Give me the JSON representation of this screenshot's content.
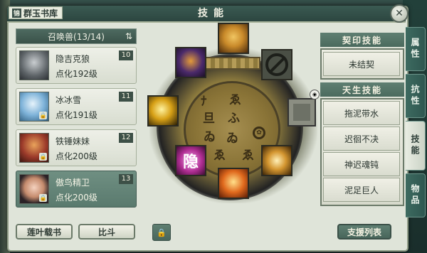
{
  "header": {
    "library_logo": "锦",
    "library_name": "群玉书库",
    "title": "技能",
    "close_glyph": "✕"
  },
  "pet_list": {
    "title": "召唤兽(13/14)",
    "sort_glyph": "⇅",
    "items": [
      {
        "name": "隐吉克狼",
        "level": "点化192级",
        "rank": "10",
        "locked": false,
        "selected": false,
        "avatar_color": "#7b7f82"
      },
      {
        "name": "冰冰雪",
        "level": "点化191级",
        "rank": "11",
        "locked": true,
        "selected": false,
        "avatar_color": "#6fa3c9"
      },
      {
        "name": "铁锤妹妹",
        "level": "点化200级",
        "rank": "12",
        "locked": true,
        "selected": false,
        "avatar_color": "#9b3a2a"
      },
      {
        "name": "傲鸟精卫",
        "level": "点化200级",
        "rank": "13",
        "locked": true,
        "selected": true,
        "avatar_color": "#c58b6d"
      }
    ]
  },
  "buttons": {
    "lotus": "莲叶载书",
    "compare": "比斗",
    "lock_glyph": "🔒",
    "assist_list": "支援列表"
  },
  "center": {
    "glyphs": [
      "ﾅ",
      "ゑ",
      "旦",
      "ふ",
      "ゐ",
      "ゐ",
      "ゑ",
      "ゑ"
    ],
    "seal_glyph": "隐",
    "wheel_glyph": "✿",
    "eye_glyph": "◉",
    "skill_colors": {
      "lion": "#c98a2a",
      "purple": "#4b2a6b",
      "lightning": "#d7a016",
      "seal": "#b02e93",
      "fire": "#e0691d",
      "swirl": "#d49630"
    }
  },
  "right_panel": {
    "contract_title": "契印技能",
    "contract_value": "未结契",
    "innate_title": "天生技能",
    "innate_skills": [
      "拖泥带水",
      "迟徊不决",
      "神迟魂钝",
      "泥足巨人"
    ]
  },
  "side_tabs": [
    "属性",
    "抗性",
    "技能",
    "物品"
  ]
}
